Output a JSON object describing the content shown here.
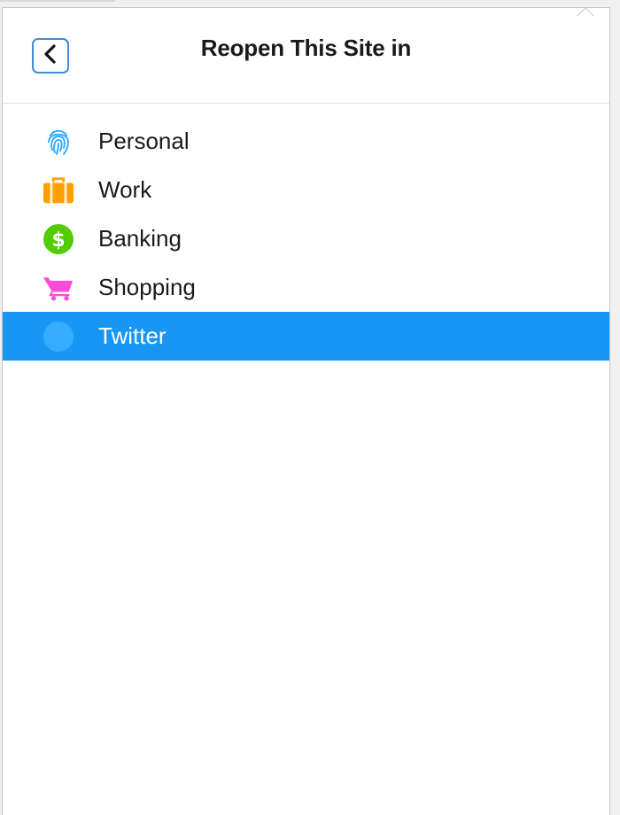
{
  "header": {
    "title": "Reopen This Site in",
    "back_icon": "chevron-left-icon"
  },
  "containers": [
    {
      "label": "Personal",
      "icon": "fingerprint-icon",
      "color": "#37adff",
      "selected": false
    },
    {
      "label": "Work",
      "icon": "briefcase-icon",
      "color": "#ff9f00",
      "selected": false
    },
    {
      "label": "Banking",
      "icon": "dollar-icon",
      "color": "#51cd00",
      "selected": false
    },
    {
      "label": "Shopping",
      "icon": "cart-icon",
      "color": "#ff4bda",
      "selected": false
    },
    {
      "label": "Twitter",
      "icon": "circle-icon",
      "color": "#37adff",
      "selected": true
    }
  ],
  "colors": {
    "selection": "#1796f5",
    "back_border": "#3d8bd9"
  }
}
